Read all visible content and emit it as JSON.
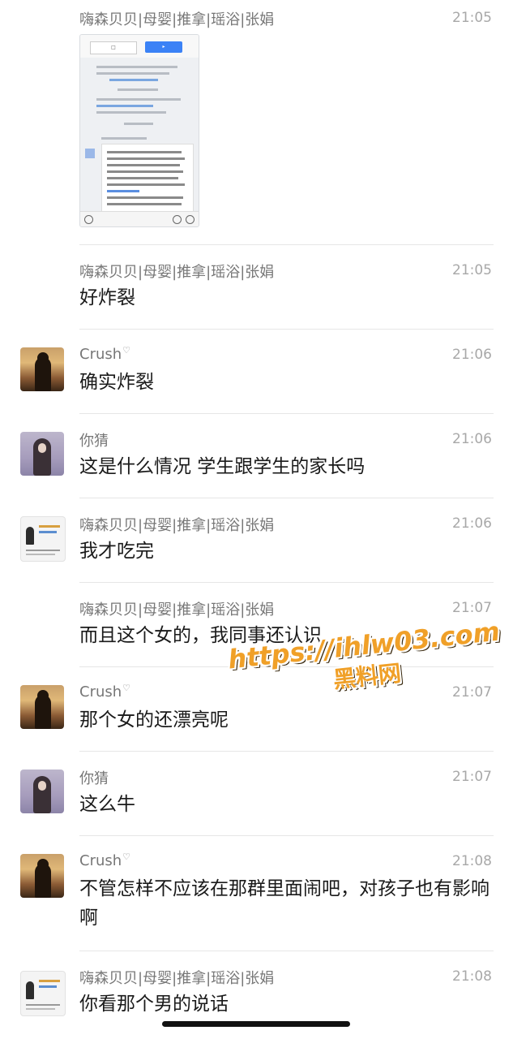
{
  "messages": [
    {
      "name": "嗨森贝贝|母婴|推拿|瑶浴|张娟",
      "time": "21:05",
      "text": "",
      "avatar": "none",
      "attachment": "screenshot-image"
    },
    {
      "name": "嗨森贝贝|母婴|推拿|瑶浴|张娟",
      "time": "21:05",
      "text": "好炸裂",
      "avatar": "none"
    },
    {
      "name": "Crush",
      "time": "21:06",
      "text": "确实炸裂",
      "avatar": "crush"
    },
    {
      "name": "你猜",
      "time": "21:06",
      "text": "这是什么情况 学生跟学生的家长吗",
      "avatar": "nicai"
    },
    {
      "name": "嗨森贝贝|母婴|推拿|瑶浴|张娟",
      "time": "21:06",
      "text": "我才吃完",
      "avatar": "card"
    },
    {
      "name": "嗨森贝贝|母婴|推拿|瑶浴|张娟",
      "time": "21:07",
      "text": "而且这个女的，我同事还认识",
      "avatar": "none"
    },
    {
      "name": "Crush",
      "time": "21:07",
      "text": "那个女的还漂亮呢",
      "avatar": "crush"
    },
    {
      "name": "你猜",
      "time": "21:07",
      "text": "这么牛",
      "avatar": "nicai"
    },
    {
      "name": "Crush",
      "time": "21:08",
      "text": "不管怎样不应该在那群里面闹吧，对孩子也有影响啊",
      "avatar": "crush"
    },
    {
      "name": "嗨森贝贝|母婴|推拿|瑶浴|张娟",
      "time": "21:08",
      "text": "你看那个男的说话",
      "avatar": "card"
    }
  ],
  "watermark": {
    "url": "https://ihlw03.com",
    "label": "黑料网"
  },
  "icons": {
    "heart": "heart-icon",
    "card_avatar": "business-card-avatar"
  }
}
